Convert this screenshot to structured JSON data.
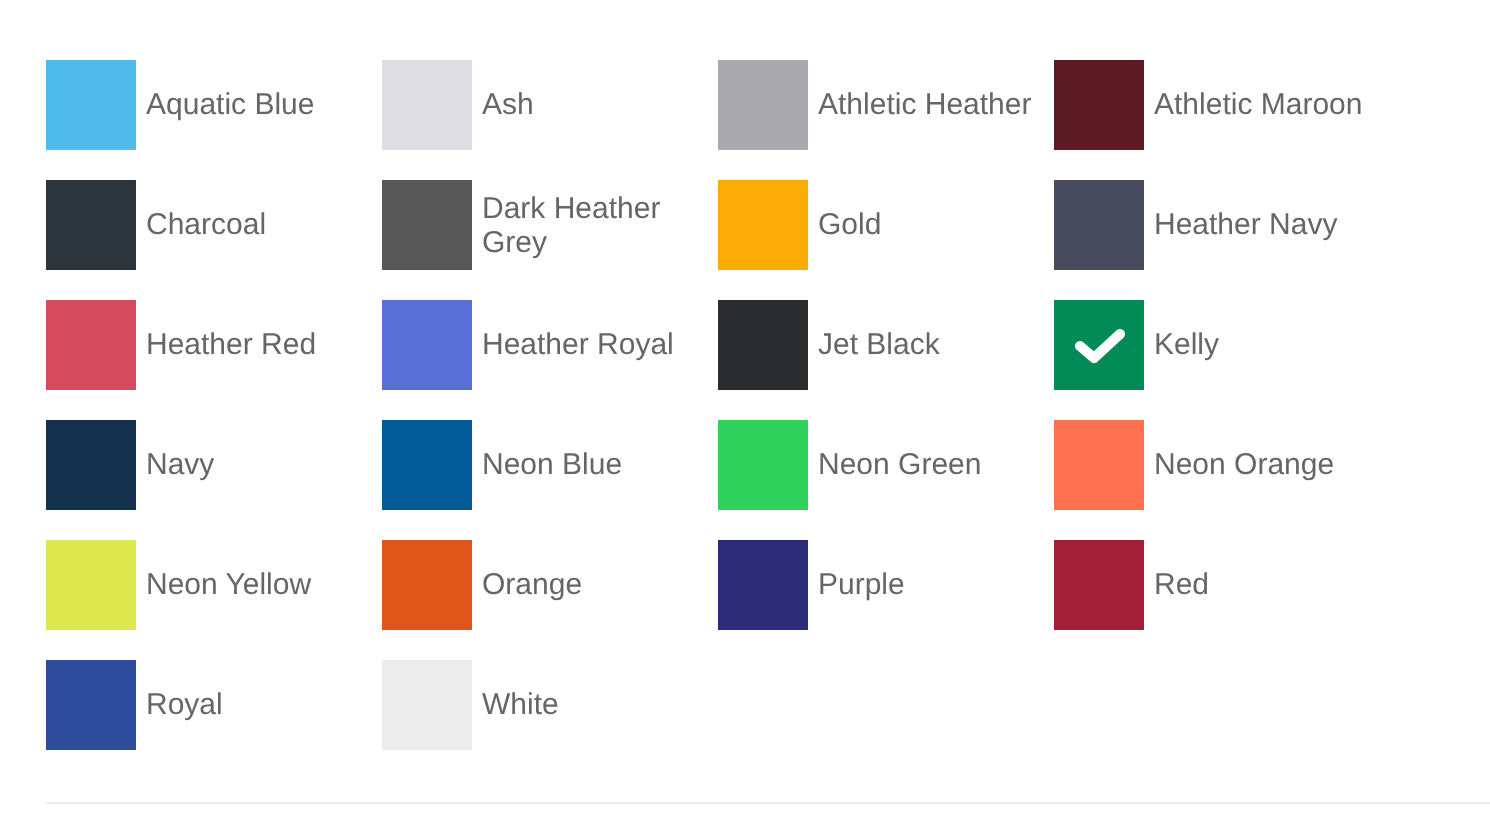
{
  "swatches": [
    {
      "label": "Aquatic Blue",
      "color": "#4fbbe9",
      "selected": false
    },
    {
      "label": "Ash",
      "color": "#dedee2",
      "selected": false
    },
    {
      "label": "Athletic Heather",
      "color": "#a9a9ae",
      "selected": false
    },
    {
      "label": "Athletic Maroon",
      "color": "#5c1a23",
      "selected": false
    },
    {
      "label": "Charcoal",
      "color": "#2e363d",
      "selected": false
    },
    {
      "label": "Dark Heather Grey",
      "color": "#575757",
      "selected": false
    },
    {
      "label": "Gold",
      "color": "#fbab06",
      "selected": false
    },
    {
      "label": "Heather Navy",
      "color": "#474a5c",
      "selected": false
    },
    {
      "label": "Heather Red",
      "color": "#d54a5e",
      "selected": false
    },
    {
      "label": "Heather Royal",
      "color": "#5a6fd6",
      "selected": false
    },
    {
      "label": "Jet Black",
      "color": "#2a2c2e",
      "selected": false
    },
    {
      "label": "Kelly",
      "color": "#028a57",
      "selected": true
    },
    {
      "label": "Navy",
      "color": "#13304c",
      "selected": false
    },
    {
      "label": "Neon Blue",
      "color": "#035a98",
      "selected": false
    },
    {
      "label": "Neon Green",
      "color": "#2dd15c",
      "selected": false
    },
    {
      "label": "Neon Orange",
      "color": "#ff7150",
      "selected": false
    },
    {
      "label": "Neon Yellow",
      "color": "#dce84e",
      "selected": false
    },
    {
      "label": "Orange",
      "color": "#e0561a",
      "selected": false
    },
    {
      "label": "Purple",
      "color": "#2c2c78",
      "selected": false
    },
    {
      "label": "Red",
      "color": "#a31f38",
      "selected": false
    },
    {
      "label": "Royal",
      "color": "#2e4c9e",
      "selected": false
    },
    {
      "label": "White",
      "color": "#ececec",
      "selected": false
    }
  ]
}
